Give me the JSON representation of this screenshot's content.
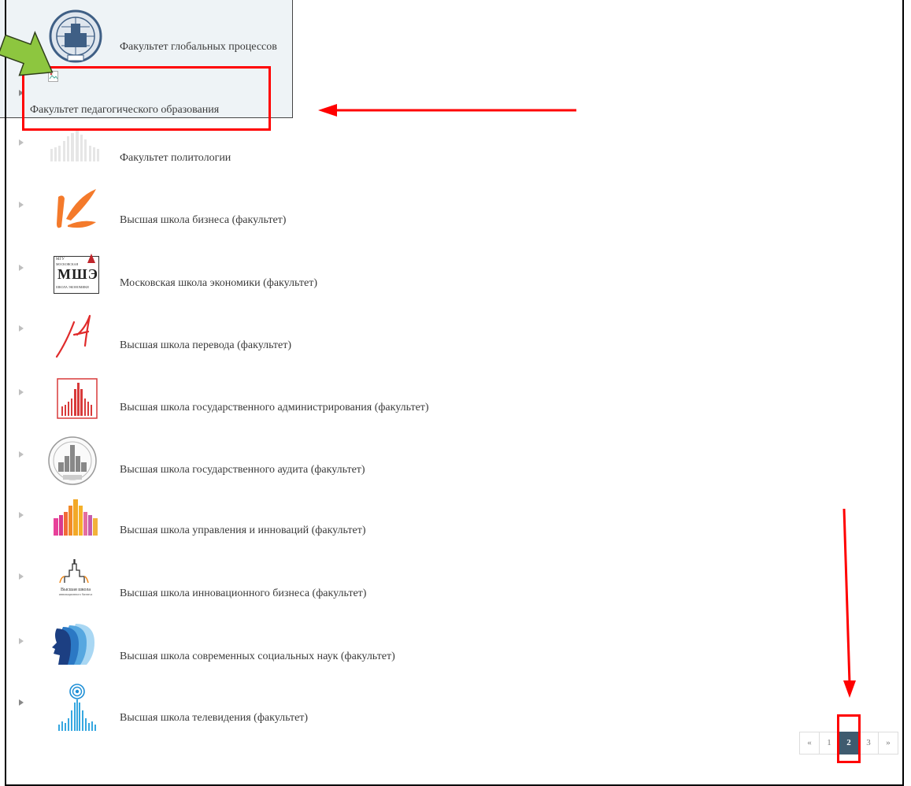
{
  "faculties": [
    {
      "label": "Факультет глобальных процессов",
      "logo": "globe-building-emblem-icon"
    },
    {
      "label": "Факультет педагогического образования",
      "logo": "broken-image-icon"
    },
    {
      "label": "Факультет политологии",
      "logo": "university-skyline-icon"
    },
    {
      "label": "Высшая школа бизнеса (факультет)",
      "logo": "orange-swoosh-icon"
    },
    {
      "label": "Московская школа экономики (факультет)",
      "logo": "mse-logo-icon",
      "logo_text": [
        "МГУ",
        "МОСКОВСКАЯ",
        "МШЭ",
        "ШКОЛА ЭКОНОМИКИ"
      ]
    },
    {
      "label": "Высшая школа перевода (факультет)",
      "logo": "red-script-letter-icon"
    },
    {
      "label": "Высшая школа государственного администрирования (факультет)",
      "logo": "red-framed-building-icon"
    },
    {
      "label": "Высшая школа государственного аудита (факультет)",
      "logo": "grey-seal-building-icon"
    },
    {
      "label": "Высшая школа управления и инноваций (факультет)",
      "logo": "colorful-skyline-icon"
    },
    {
      "label": "Высшая школа инновационного бизнеса (факультет)",
      "logo": "tower-outline-icon",
      "logo_text": [
        "Высшая школа",
        "инновационного бизнеса"
      ]
    },
    {
      "label": "Высшая школа современных социальных наук (факультет)",
      "logo": "blue-profiles-icon"
    },
    {
      "label": "Высшая школа телевидения (факультет)",
      "logo": "tv-antenna-signal-icon"
    }
  ],
  "pagination": {
    "prev": "«",
    "pages": [
      "1",
      "2",
      "3"
    ],
    "current": "2",
    "next": "»"
  },
  "colors": {
    "annotation_red": "#ff0000",
    "annotation_green": "#8dc63f",
    "pager_active": "#3f5b6f"
  }
}
